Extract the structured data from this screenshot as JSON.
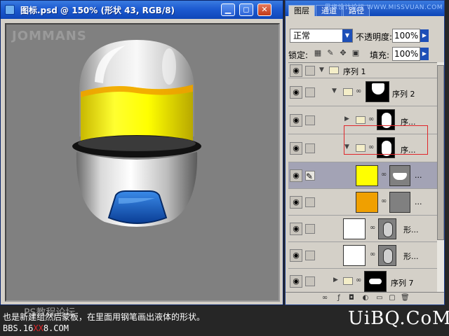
{
  "document": {
    "title": "图标.psd @ 150% (形状 43, RGB/8)",
    "canvas_watermark": "JOMMANS"
  },
  "window_controls": {
    "minimize": "▁",
    "maximize": "◻",
    "close": "✕"
  },
  "layers_panel": {
    "tabs": [
      "图层",
      "通道",
      "路径"
    ],
    "watermark": "思缘设计论坛 WWW.MISSVUAN.COM",
    "blend_mode": "正常",
    "opacity_label": "不透明度:",
    "opacity_value": "100%",
    "lock_label": "锁定:",
    "fill_label": "填充:",
    "fill_value": "100%",
    "layers": [
      {
        "name": "序列 1",
        "type": "group",
        "expanded": true
      },
      {
        "name": "序列 2",
        "type": "group",
        "expanded": true
      },
      {
        "name": "序...",
        "type": "group",
        "expanded": false
      },
      {
        "name": "序...",
        "type": "group",
        "expanded": true
      },
      {
        "name": "...",
        "type": "layer",
        "thumb_color": "#ffff00",
        "selected": true
      },
      {
        "name": "...",
        "type": "layer",
        "thumb_color": "#f0a000"
      },
      {
        "name": "形...",
        "type": "layer",
        "thumb_color": "#ffffff"
      },
      {
        "name": "形...",
        "type": "layer",
        "thumb_color": "#ffffff"
      },
      {
        "name": "序列 7",
        "type": "group",
        "expanded": false
      }
    ]
  },
  "caption": {
    "line1": "也是新建组然后蒙板，在里面用钢笔画出液体的形状。",
    "line1_overlay": "PS教程论坛",
    "line2_prefix": "BBS.16",
    "line2_red": "XX",
    "line2_suffix": "8.COM",
    "brand": "UiBQ.CoM"
  },
  "colors": {
    "liquid_yellow": "#ffff00",
    "liquid_orange": "#f0a000",
    "visor_blue": "#1a66cc",
    "highlight_red": "#e0262a",
    "title_blue": "#1d5bd1"
  }
}
